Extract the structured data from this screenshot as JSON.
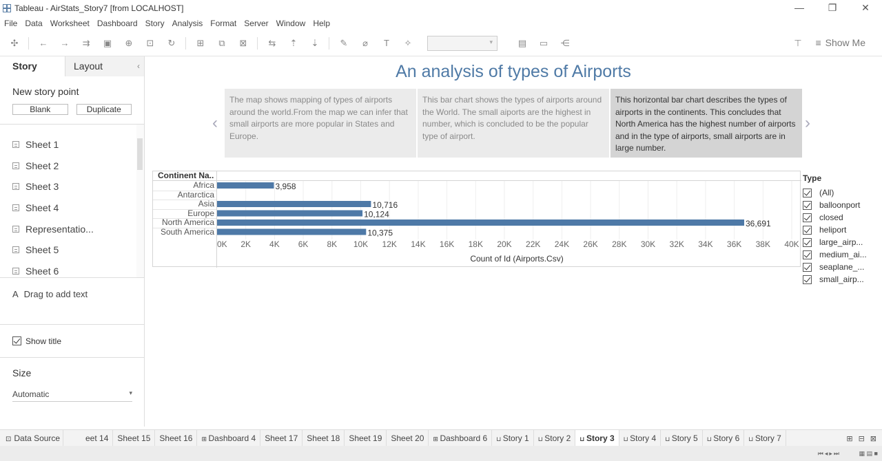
{
  "window": {
    "title": "Tableau - AirStats_Story7 [from LOCALHOST]",
    "controls": [
      "—",
      "❐",
      "✕"
    ]
  },
  "menu": [
    "File",
    "Data",
    "Worksheet",
    "Dashboard",
    "Story",
    "Analysis",
    "Format",
    "Server",
    "Window",
    "Help"
  ],
  "toolbar": {
    "show_me_label": "Show Me"
  },
  "left_pane": {
    "tab_story": "Story",
    "tab_layout": "Layout",
    "new_story_point": "New story point",
    "blank_btn": "Blank",
    "duplicate_btn": "Duplicate",
    "sheets": [
      "Sheet 1",
      "Sheet 2",
      "Sheet 3",
      "Sheet 4",
      "Representatio...",
      "Sheet 5",
      "Sheet 6"
    ],
    "drag_text": "Drag to add text",
    "show_title": "Show title",
    "size_heading": "Size",
    "size_value": "Automatic"
  },
  "story": {
    "title": "An analysis of types of Airports",
    "captions": [
      "The map shows mapping of types of airports around the world.From the map we can infer that small airports are more popular in States and Europe.",
      "This bar chart shows the types of airports around the World. The small aiports are the highest in number, which is concluded to be the popular type of airport.",
      "This horizontal bar chart describes the types of airports in the continents. This concludes that North America has the highest number of airports and in the type of airports, small airports are in large number."
    ],
    "active_caption": 2,
    "prev_arrow": "‹",
    "next_arrow": "›"
  },
  "chart_data": {
    "type": "bar",
    "orientation": "horizontal",
    "header": "Continent Na..",
    "categories": [
      "Africa",
      "Antarctica",
      "Asia",
      "Europe",
      "North America",
      "South America"
    ],
    "values": [
      3958,
      0,
      10716,
      10124,
      36691,
      10375
    ],
    "value_labels": [
      "3,958",
      "",
      "10,716",
      "10,124",
      "36,691",
      "10,375"
    ],
    "xlabel": "Count of Id (Airports.Csv)",
    "xticks": [
      "0K",
      "2K",
      "4K",
      "6K",
      "8K",
      "10K",
      "12K",
      "14K",
      "16K",
      "18K",
      "20K",
      "22K",
      "24K",
      "26K",
      "28K",
      "30K",
      "32K",
      "34K",
      "36K",
      "38K",
      "40K"
    ],
    "xlim": [
      0,
      40000
    ],
    "bar_color": "#4e79a7",
    "grid": true
  },
  "legend": {
    "title": "Type",
    "items": [
      "(All)",
      "balloonport",
      "closed",
      "heliport",
      "large_airp...",
      "medium_ai...",
      "seaplane_...",
      "small_airp..."
    ]
  },
  "bottom_tabs": {
    "data_source": "Data Source",
    "tabs": [
      "eet 14",
      "Sheet 15",
      "Sheet 16",
      "Dashboard 4",
      "Sheet 17",
      "Sheet 18",
      "Sheet 19",
      "Sheet 20",
      "Dashboard 6",
      "Story 1",
      "Story 2",
      "Story 3",
      "Story 4",
      "Story 5",
      "Story 6",
      "Story 7"
    ],
    "active": "Story 3"
  }
}
